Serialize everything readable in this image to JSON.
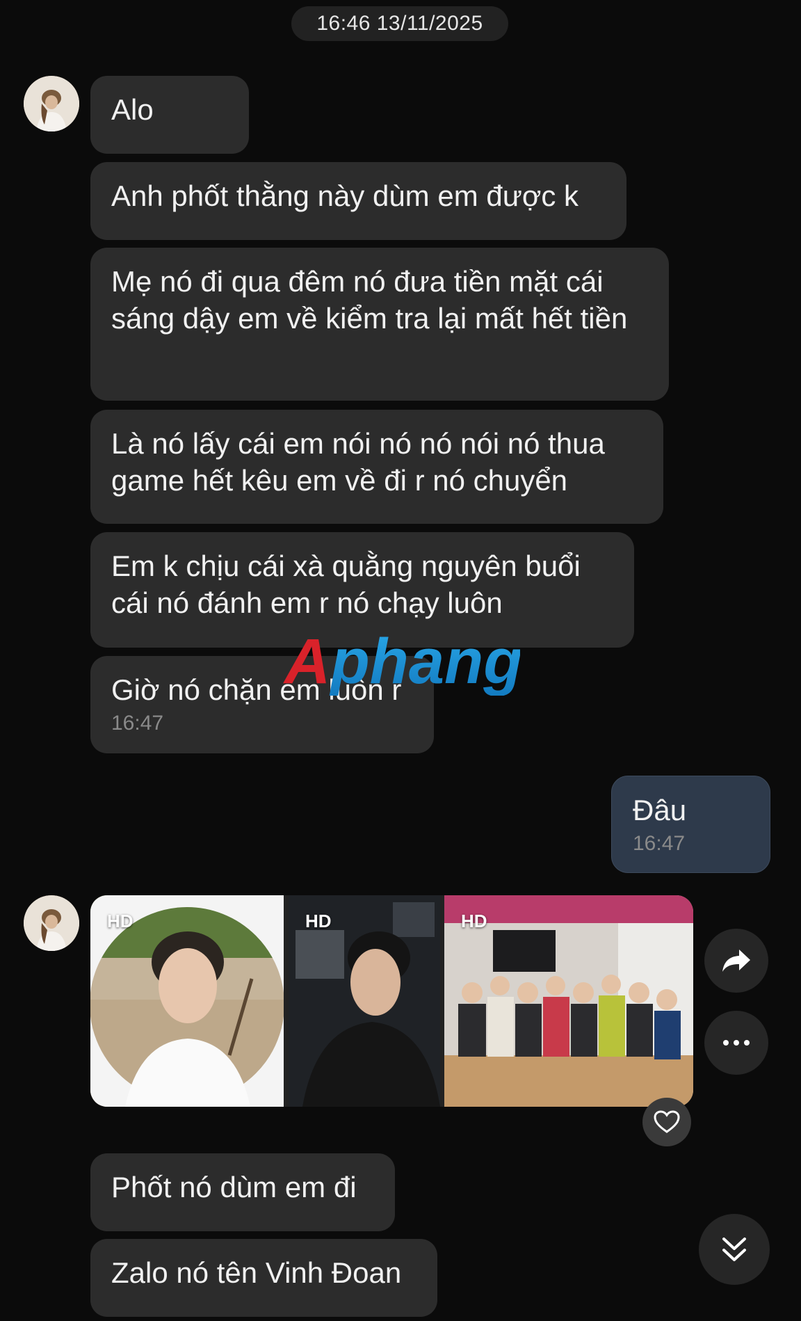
{
  "timestamp": "16:46 13/11/2025",
  "messages": [
    {
      "text": "Alo"
    },
    {
      "text": "Anh phốt thằng này dùm em được k"
    },
    {
      "text": "Mẹ nó đi qua đêm nó đưa tiền mặt cái sáng dậy em về kiểm tra lại mất hết tiền"
    },
    {
      "text": "Là nó lấy cái em nói nó nó nói nó thua game hết kêu em về đi r nó chuyển"
    },
    {
      "text": "Em k chịu cái xà quằng nguyên buổi cái nó đánh em r nó chạy luôn"
    },
    {
      "text": "Giờ nó chặn em luôn r",
      "time": "16:47"
    }
  ],
  "my_reply": {
    "text": "Đâu",
    "time": "16:47"
  },
  "photos": [
    {
      "badge": "HD"
    },
    {
      "badge": "HD"
    },
    {
      "badge": "HD"
    }
  ],
  "messages_after": [
    {
      "text": "Phốt nó dùm em đi"
    },
    {
      "text": "Zalo nó tên Vinh Đoan"
    }
  ],
  "watermark": "Aphang",
  "icons": {
    "forward": "share-forward-icon",
    "more": "more-dots-icon",
    "heart": "heart-icon",
    "scroll": "double-chevron-down-icon"
  },
  "colors": {
    "background": "#0b0b0b",
    "incoming_bubble": "#2c2c2c",
    "outgoing_bubble": "#2e3a4b",
    "time_text": "#8a8a8a"
  }
}
